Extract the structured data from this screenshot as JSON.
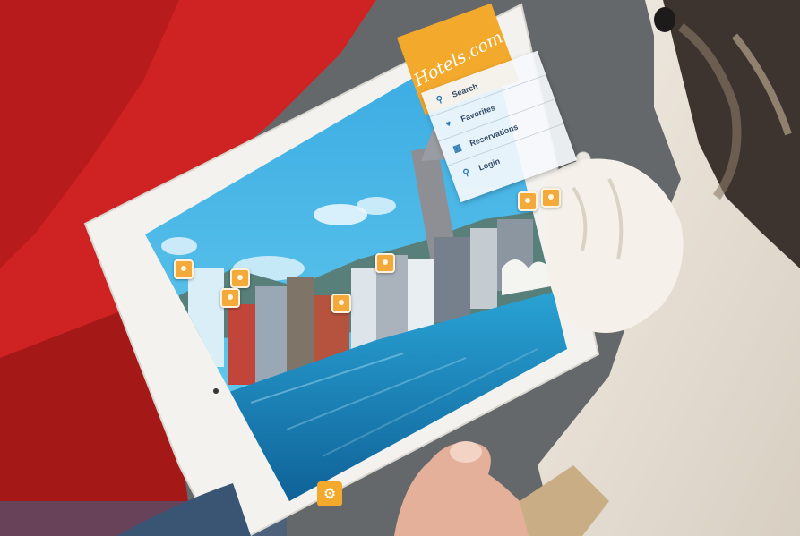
{
  "app": {
    "logo_text": "Hotels.com",
    "menu": [
      {
        "label": "Search",
        "icon": "search-icon"
      },
      {
        "label": "Favorites",
        "icon": "heart-icon"
      },
      {
        "label": "Reservations",
        "icon": "calendar-icon"
      },
      {
        "label": "Login",
        "icon": "key-icon"
      }
    ],
    "settings_icon": "gear-icon"
  },
  "colors": {
    "brand_orange": "#f3a92c",
    "sky_blue": "#3fb5e6",
    "water_blue": "#1f86c0",
    "red_sofa": "#c81e1e",
    "tablet_white": "#f4f2ee"
  }
}
